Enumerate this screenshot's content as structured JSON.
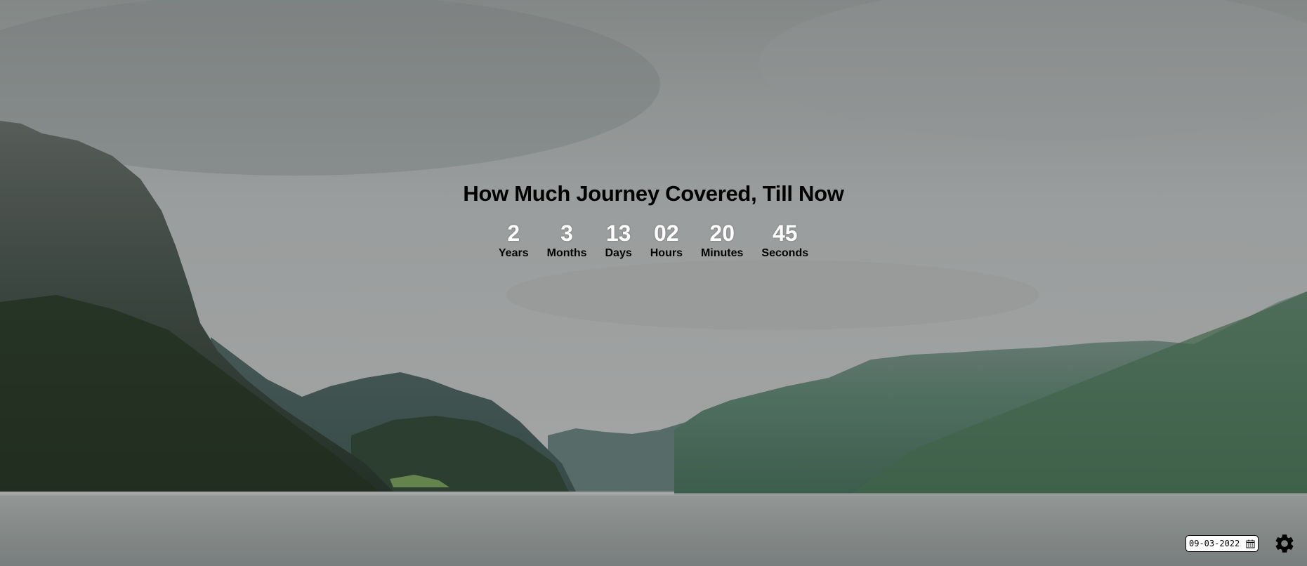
{
  "title": "How Much Journey Covered, Till Now",
  "counter": [
    {
      "value": "2",
      "label": "Years"
    },
    {
      "value": "3",
      "label": "Months"
    },
    {
      "value": "13",
      "label": "Days"
    },
    {
      "value": "02",
      "label": "Hours"
    },
    {
      "value": "20",
      "label": "Minutes"
    },
    {
      "value": "45",
      "label": "Seconds"
    }
  ],
  "date_picker": {
    "value": "09-03-2022",
    "icon": "calendar-icon"
  },
  "settings": {
    "icon": "gear-icon"
  },
  "background": {
    "description_icon": "landscape-background",
    "colors": {
      "sky": "#9fa3a3",
      "sky_dark": "#7c8380",
      "mountain_dark": "#2a3a30",
      "mountain_mid": "#4d6a60",
      "water": "#8a9090"
    }
  }
}
